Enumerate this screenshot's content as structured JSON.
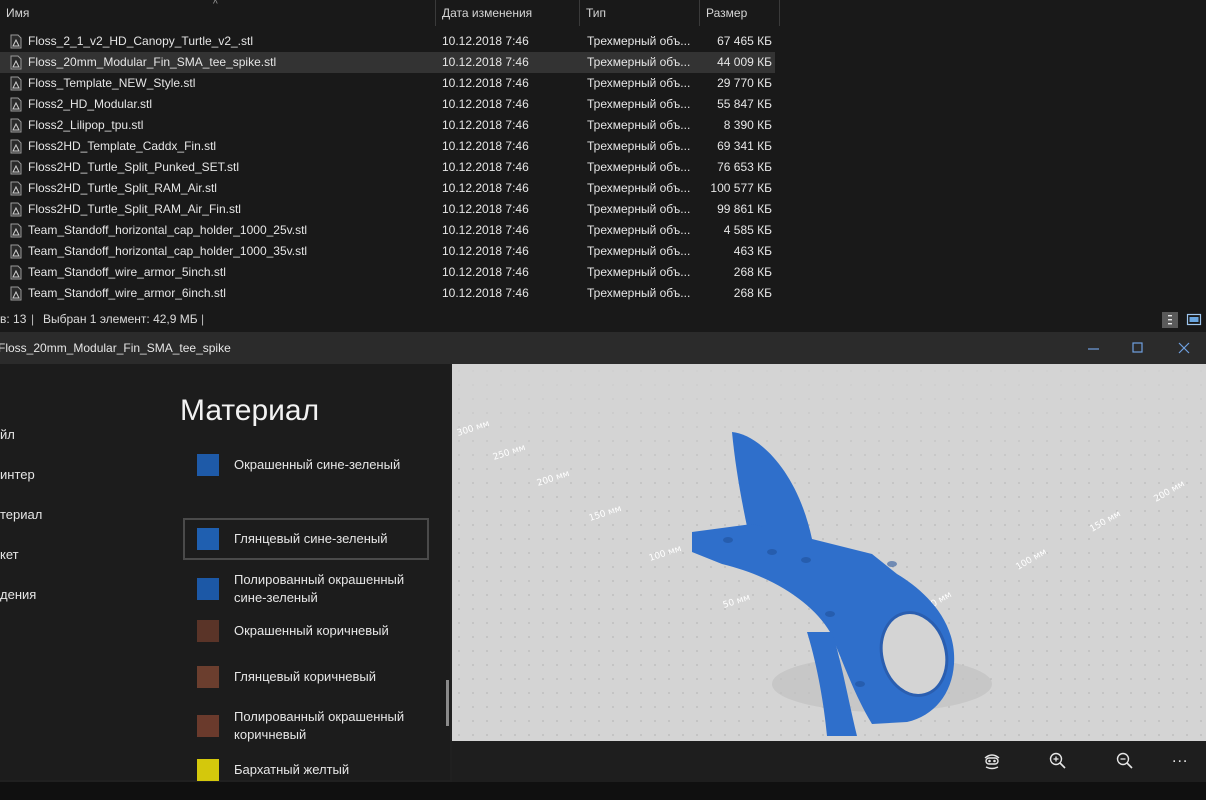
{
  "explorer": {
    "columns": {
      "name": "Имя",
      "date": "Дата изменения",
      "type": "Тип",
      "size": "Размер"
    },
    "sort_indicator": "^",
    "files": [
      {
        "name": "Floss_2_1_v2_HD_Canopy_Turtle_v2_.stl",
        "date": "10.12.2018 7:46",
        "type": "Трехмерный объ...",
        "size": "67 465 КБ"
      },
      {
        "name": "Floss_20mm_Modular_Fin_SMA_tee_spike.stl",
        "date": "10.12.2018 7:46",
        "type": "Трехмерный объ...",
        "size": "44 009 КБ",
        "selected": true
      },
      {
        "name": "Floss_Template_NEW_Style.stl",
        "date": "10.12.2018 7:46",
        "type": "Трехмерный объ...",
        "size": "29 770 КБ"
      },
      {
        "name": "Floss2_HD_Modular.stl",
        "date": "10.12.2018 7:46",
        "type": "Трехмерный объ...",
        "size": "55 847 КБ"
      },
      {
        "name": "Floss2_Lilipop_tpu.stl",
        "date": "10.12.2018 7:46",
        "type": "Трехмерный объ...",
        "size": "8 390 КБ"
      },
      {
        "name": "Floss2HD_Template_Caddx_Fin.stl",
        "date": "10.12.2018 7:46",
        "type": "Трехмерный объ...",
        "size": "69 341 КБ"
      },
      {
        "name": "Floss2HD_Turtle_Split_Punked_SET.stl",
        "date": "10.12.2018 7:46",
        "type": "Трехмерный объ...",
        "size": "76 653 КБ"
      },
      {
        "name": "Floss2HD_Turtle_Split_RAM_Air.stl",
        "date": "10.12.2018 7:46",
        "type": "Трехмерный объ...",
        "size": "100 577 КБ"
      },
      {
        "name": "Floss2HD_Turtle_Split_RAM_Air_Fin.stl",
        "date": "10.12.2018 7:46",
        "type": "Трехмерный объ...",
        "size": "99 861 КБ"
      },
      {
        "name": "Team_Standoff_horizontal_cap_holder_1000_25v.stl",
        "date": "10.12.2018 7:46",
        "type": "Трехмерный объ...",
        "size": "4 585 КБ"
      },
      {
        "name": "Team_Standoff_horizontal_cap_holder_1000_35v.stl",
        "date": "10.12.2018 7:46",
        "type": "Трехмерный объ...",
        "size": "463 КБ"
      },
      {
        "name": "Team_Standoff_wire_armor_5inch.stl",
        "date": "10.12.2018 7:46",
        "type": "Трехмерный объ...",
        "size": "268 КБ"
      },
      {
        "name": "Team_Standoff_wire_armor_6inch.stl",
        "date": "10.12.2018 7:46",
        "type": "Трехмерный объ...",
        "size": "268 КБ"
      }
    ],
    "status": {
      "count": "в: 13",
      "separator": "|",
      "selection": "Выбран 1 элемент: 42,9 МБ"
    }
  },
  "viewer": {
    "title": "Floss_20mm_Modular_Fin_SMA_tee_spike",
    "nav": [
      "йл",
      "интер",
      "териал",
      "кет",
      "дения"
    ],
    "panel_title": "Материал",
    "materials": [
      {
        "label": "Окрашенный сине-зеленый",
        "color": "#1e5aa8"
      },
      {
        "label": "Глянцевый сине-зеленый",
        "color": "#1f5fb0",
        "selected": true
      },
      {
        "label": "Полированный окрашенный сине-зеленый",
        "color": "#1c58a6"
      },
      {
        "label": "Окрашенный коричневый",
        "color": "#5a3428"
      },
      {
        "label": "Глянцевый коричневый",
        "color": "#6b3e2e"
      },
      {
        "label": "Полированный окрашенный коричневый",
        "color": "#6a3a2c"
      },
      {
        "label": "Бархатный желтый",
        "color": "#d4c80c"
      }
    ],
    "scene": {
      "model_color": "#2f6fcb",
      "ruler_labels": [
        "300 мм",
        "250 мм",
        "200 мм",
        "150 мм",
        "100 мм",
        "50 мм",
        "50 мм",
        "100 мм",
        "150 мм",
        "200 мм"
      ]
    },
    "toolbar": {
      "more": "..."
    }
  }
}
